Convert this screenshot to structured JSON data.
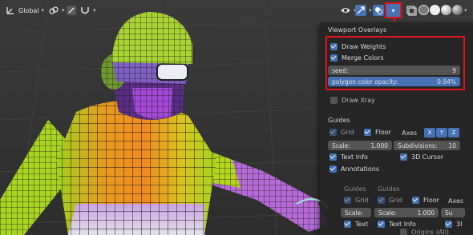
{
  "toolbar": {
    "transform_orientation": "Global"
  },
  "overlay_popover": {
    "title": "Viewport Overlays",
    "draw_weights_label": "Draw Weights",
    "merge_colors_label": "Merge Colors",
    "seed_label": "seed:",
    "seed_value": "9",
    "opacity_label": "polygon color opacity:",
    "opacity_value": "0.94%",
    "draw_xray_label": "Draw Xray",
    "guides_title": "Guides",
    "grid_label": "Grid",
    "floor_label": "Floor",
    "axes_label": "Axes",
    "axis_x": "X",
    "axis_y": "Y",
    "axis_z": "Z",
    "scale_label": "Scale:",
    "scale_value": "1.000",
    "subdivisions_label": "Subdivisions:",
    "subdivisions_value": "10",
    "text_info_label": "Text Info",
    "cursor_label": "3D Cursor",
    "annotations_label": "Annotations"
  },
  "ghost_panel": {
    "guides_a": "Guides",
    "guides_b": "Guides",
    "grid_label": "Grid",
    "grid_label_b": "Grid",
    "floor_label": "Floor",
    "axes_label": "Axes",
    "scale_label_a": "Scale:",
    "scale_label_b": "Scale:",
    "scale_value": "1.000",
    "subd_value": "Su",
    "text_label_a": "Text",
    "text_info_label": "Text Info",
    "cursor_short": "3I",
    "origins_label": "Origins (All)"
  },
  "colors": {
    "accent": "#4772b3",
    "highlight": "#e0141c",
    "popover_bg": "#262626"
  }
}
